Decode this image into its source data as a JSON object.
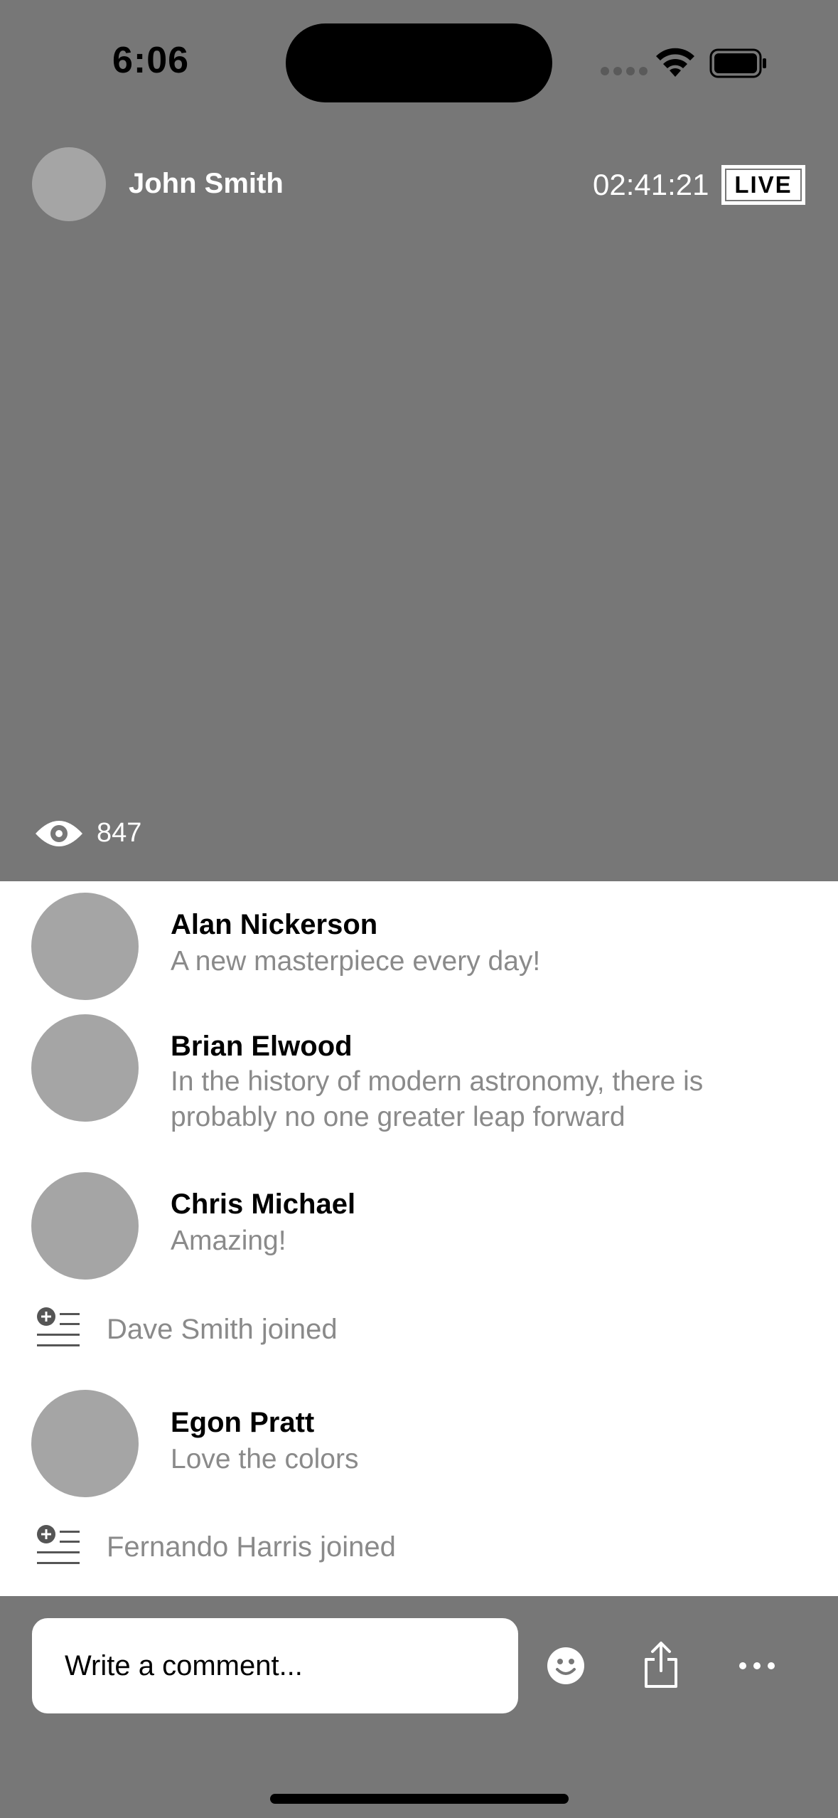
{
  "status_bar": {
    "time": "6:06"
  },
  "broadcast": {
    "host_name": "John Smith",
    "elapsed": "02:41:21",
    "live_label": "LIVE",
    "viewer_count": "847"
  },
  "comments": [
    {
      "type": "message",
      "name": "Alan Nickerson",
      "text": "A new masterpiece every day!"
    },
    {
      "type": "message",
      "name": "Brian Elwood",
      "text": "In the history of modern astronomy, there is probably no one greater leap forward"
    },
    {
      "type": "message",
      "name": "Chris Michael",
      "text": "Amazing!"
    },
    {
      "type": "join",
      "text": "Dave Smith joined"
    },
    {
      "type": "message",
      "name": "Egon Pratt",
      "text": "Love the colors"
    },
    {
      "type": "join",
      "text": "Fernando Harris joined"
    }
  ],
  "composer": {
    "placeholder": "Write a comment..."
  },
  "icons": {
    "wifi": "wifi-icon",
    "battery": "battery-icon",
    "viewers": "eye-icon",
    "join": "join-list-icon",
    "emoji": "smiley-icon",
    "share": "share-icon",
    "more": "more-icon"
  },
  "colors": {
    "video_background": "#777777",
    "avatar_placeholder": "#a5a5a5",
    "secondary_text": "#8a8a8a"
  }
}
